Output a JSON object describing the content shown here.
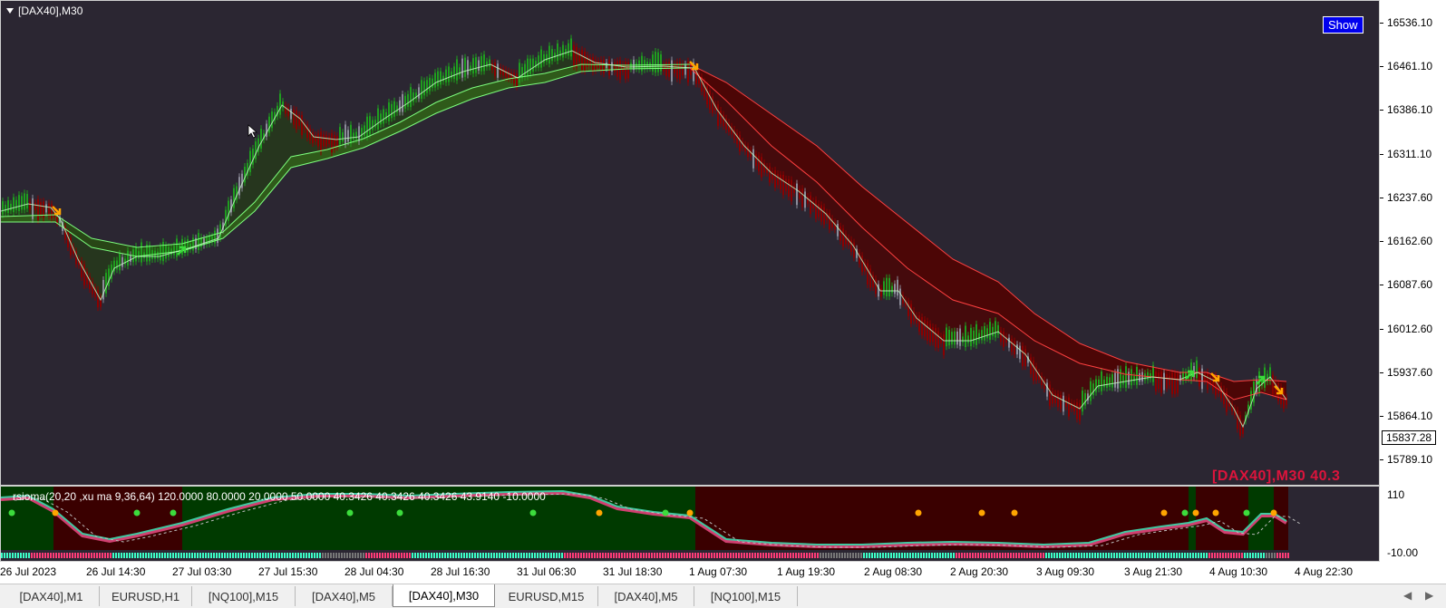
{
  "chart": {
    "title": "[DAX40],M30",
    "show_button": "Show",
    "watermark": "[DAX40],M30  40.3",
    "current_price": "15837.28",
    "price_labels": [
      "16536.10",
      "16461.10",
      "16386.10",
      "16311.10",
      "16237.60",
      "16162.60",
      "16087.60",
      "16012.60",
      "15937.60",
      "15864.10",
      "15789.10"
    ],
    "colors": {
      "background": "#2b2632",
      "bull": "#1f9e1f",
      "bear": "#8b0000",
      "band_bull": "#2f5a1a",
      "band_bear": "#5a0a0a"
    }
  },
  "indicator": {
    "label": "rsioma(20,20 ,xu ma 9,36,64) 120.0000 80.0000 20.0000 50.0000 40.3426 40.3426 40.3426 43.9140 -10.0000",
    "axis_labels": [
      "110",
      "-10.00"
    ]
  },
  "time_axis": {
    "labels": [
      "26 Jul 2023",
      "26 Jul 14:30",
      "27 Jul 03:30",
      "27 Jul 15:30",
      "28 Jul 04:30",
      "28 Jul 16:30",
      "31 Jul 06:30",
      "31 Jul 18:30",
      "1 Aug 07:30",
      "1 Aug 19:30",
      "2 Aug 08:30",
      "2 Aug 20:30",
      "3 Aug 09:30",
      "3 Aug 21:30",
      "4 Aug 10:30",
      "4 Aug 22:30"
    ]
  },
  "tabs": [
    {
      "label": "[DAX40],M1",
      "active": false
    },
    {
      "label": "EURUSD,H1",
      "active": false
    },
    {
      "label": "[NQ100],M15",
      "active": false
    },
    {
      "label": "[DAX40],M5",
      "active": false
    },
    {
      "label": "[DAX40],M30",
      "active": true
    },
    {
      "label": "EURUSD,M15",
      "active": false
    },
    {
      "label": "[DAX40],M5",
      "active": false
    },
    {
      "label": "[NQ100],M15",
      "active": false
    }
  ],
  "tab_scroll": {
    "left_icon": "◀",
    "right_icon": "▶"
  }
}
